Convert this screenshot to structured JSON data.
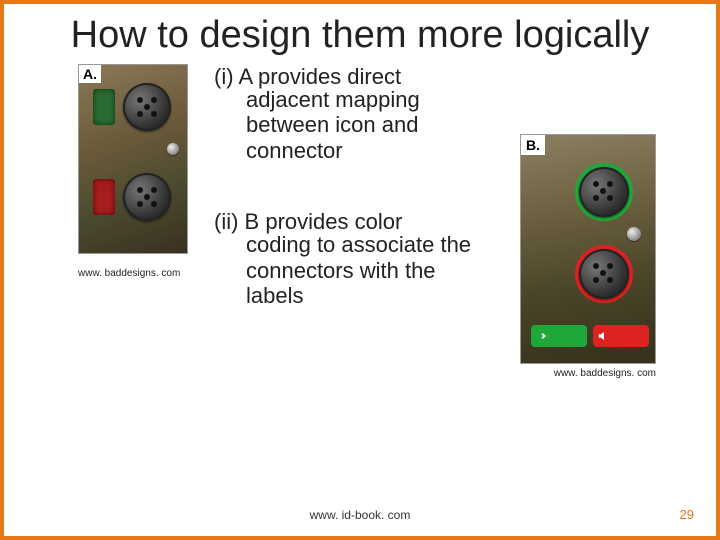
{
  "title": "How to design them more logically",
  "points": {
    "p1_prefix": "(i) ",
    "p1_line1": "A provides direct",
    "p1_rest": "adjacent mapping between icon and connector",
    "p2_prefix": "(ii) ",
    "p2_line1": "B provides color",
    "p2_rest": "coding to associate the connectors with the labels"
  },
  "labels": {
    "a": "A.",
    "b": "B."
  },
  "credits": {
    "baddesigns": "www. baddesigns. com",
    "idbook": "www. id-book. com"
  },
  "page_number": "29",
  "colors": {
    "accent": "#e77817",
    "green": "#1fa83a",
    "red": "#d22"
  }
}
